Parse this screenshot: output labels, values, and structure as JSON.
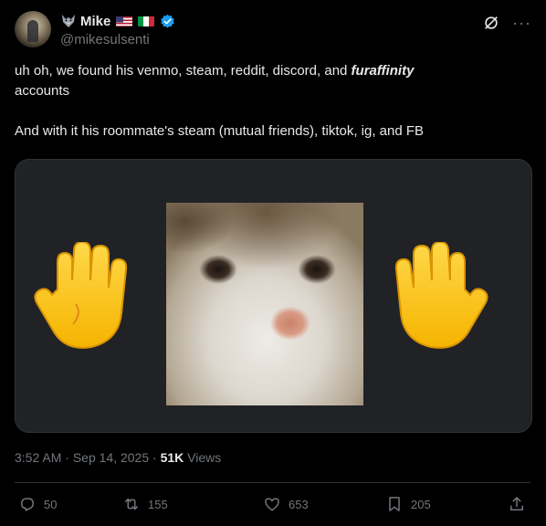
{
  "author": {
    "display_name": "Mike",
    "handle": "@mikesulsenti",
    "verified": true,
    "flags": [
      "us-flag-icon",
      "italy-flag-icon"
    ],
    "emoji": "wolf-icon"
  },
  "tweet": {
    "line1_prefix": "uh oh, we found his venmo, steam, reddit, discord, and ",
    "line1_emphasis": "furaffinity",
    "line1_suffix": "accounts",
    "line2": "And with it his roommate's steam (mutual friends), tiktok, ig, and FB"
  },
  "media": {
    "left_icon": "raised-hand-icon",
    "center": "cat-image",
    "right_icon": "raised-hand-icon"
  },
  "meta": {
    "time": "3:52 AM",
    "sep1": " · ",
    "date": "Sep 14, 2025",
    "sep2": " · ",
    "views_count": "51K",
    "views_label": " Views"
  },
  "actions": {
    "replies": "50",
    "reposts": "155",
    "likes": "653",
    "bookmarks": "205"
  },
  "colors": {
    "background": "#000000",
    "text": "#e7e9ea",
    "secondary": "#71767b",
    "verified": "#1d9bf0",
    "border": "#2f3336"
  }
}
